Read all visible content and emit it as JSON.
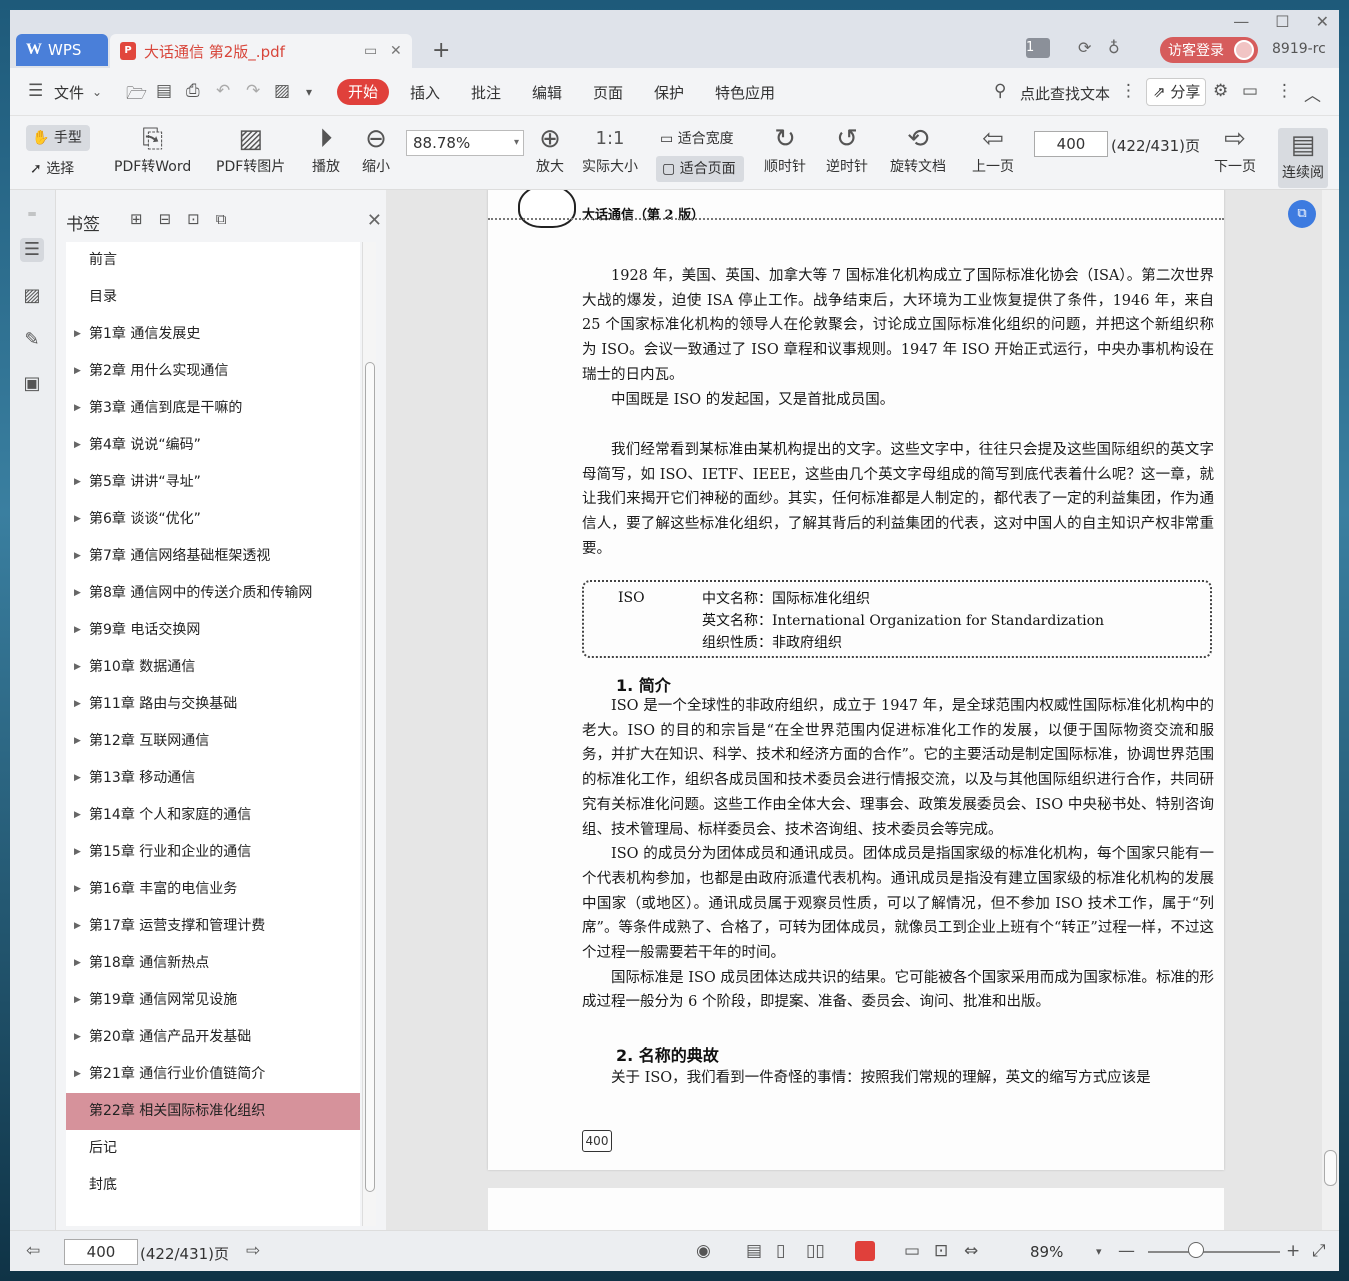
{
  "app": {
    "name": "WPS"
  },
  "tabs": {
    "doc_title": "大话通信 第2版_.pdf",
    "new_tab": "+"
  },
  "titlebar": {
    "page_badge": "1",
    "login_label": "访客登录",
    "user_id": "8919-rc"
  },
  "menu": {
    "file": "文件",
    "items": [
      "开始",
      "插入",
      "批注",
      "编辑",
      "页面",
      "保护",
      "特色应用"
    ],
    "active": "开始",
    "search_placeholder": "点此查找文本",
    "share": "分享"
  },
  "toolbar": {
    "hand": "手型",
    "select": "选择",
    "pdf_to_word": "PDF转Word",
    "pdf_to_image": "PDF转图片",
    "play": "播放",
    "zoom_out": "缩小",
    "zoom_value": "88.78%",
    "zoom_in": "放大",
    "actual_size": "实际大小",
    "fit_width": "适合宽度",
    "fit_page": "适合页面",
    "clockwise": "顺时针",
    "counter_clockwise": "逆时针",
    "rotate_doc": "旋转文档",
    "prev_page": "上一页",
    "page_input": "400",
    "page_of": "(422/431)页",
    "next_page": "下一页",
    "continuous": "连续阅"
  },
  "bookmarks": {
    "title": "书签",
    "items": [
      {
        "label": "前言",
        "expandable": false
      },
      {
        "label": "目录",
        "expandable": false
      },
      {
        "label": "第1章 通信发展史",
        "expandable": true
      },
      {
        "label": "第2章 用什么实现通信",
        "expandable": true
      },
      {
        "label": "第3章 通信到底是干嘛的",
        "expandable": true
      },
      {
        "label": "第4章 说说“编码”",
        "expandable": true
      },
      {
        "label": "第5章 讲讲“寻址”",
        "expandable": true
      },
      {
        "label": "第6章 谈谈“优化”",
        "expandable": true
      },
      {
        "label": "第7章 通信网络基础框架透视",
        "expandable": true
      },
      {
        "label": "第8章 通信网中的传送介质和传输网",
        "expandable": true
      },
      {
        "label": "第9章 电话交换网",
        "expandable": true
      },
      {
        "label": "第10章 数据通信",
        "expandable": true
      },
      {
        "label": "第11章 路由与交换基础",
        "expandable": true
      },
      {
        "label": "第12章 互联网通信",
        "expandable": true
      },
      {
        "label": "第13章 移动通信",
        "expandable": true
      },
      {
        "label": "第14章 个人和家庭的通信",
        "expandable": true
      },
      {
        "label": "第15章 行业和企业的通信",
        "expandable": true
      },
      {
        "label": "第16章 丰富的电信业务",
        "expandable": true
      },
      {
        "label": "第17章 运营支撑和管理计费",
        "expandable": true
      },
      {
        "label": "第18章 通信新热点",
        "expandable": true
      },
      {
        "label": "第19章 通信网常见设施",
        "expandable": true
      },
      {
        "label": "第20章 通信产品开发基础",
        "expandable": true
      },
      {
        "label": "第21章 通信行业价值链简介",
        "expandable": true
      },
      {
        "label": "第22章 相关国际标准化组织",
        "expandable": false,
        "active": true
      },
      {
        "label": "后记",
        "expandable": false
      },
      {
        "label": "封底",
        "expandable": false
      }
    ]
  },
  "page": {
    "running_head": "大话通信（第 2 版）",
    "para1": "1928 年，美国、英国、加拿大等 7 国标准化机构成立了国际标准化协会（ISA）。第二次世界大战的爆发，迫使 ISA 停止工作。战争结束后，大环境为工业恢复提供了条件，1946 年，来自 25 个国家标准化机构的领导人在伦敦聚会，讨论成立国际标准化组织的问题，并把这个新组织称为 ISO。会议一致通过了 ISO 章程和议事规则。1947 年 ISO 开始正式运行，中央办事机构设在瑞士的日内瓦。",
    "para2": "中国既是 ISO 的发起国，又是首批成员国。",
    "para3": "我们经常看到某标准由某机构提出的文字。这些文字中，往往只会提及这些国际组织的英文字母简写，如 ISO、IETF、IEEE，这些由几个英文字母组成的简写到底代表着什么呢？这一章，就让我们来揭开它们神秘的面纱。其实，任何标准都是人制定的，都代表了一定的利益集团，作为通信人，要了解这些标准化组织，了解其背后的利益集团的代表，这对中国人的自主知识产权非常重要。",
    "box": {
      "abbr": "ISO",
      "cn_name": "中文名称：国际标准化组织",
      "en_name": "英文名称：International Organization for Standardization",
      "nature": "组织性质：非政府组织"
    },
    "h1": "1. 简介",
    "para4": "ISO 是一个全球性的非政府组织，成立于 1947 年，是全球范围内权威性国际标准化机构中的老大。ISO 的目的和宗旨是“在全世界范围内促进标准化工作的发展，以便于国际物资交流和服务，并扩大在知识、科学、技术和经济方面的合作”。它的主要活动是制定国际标准，协调世界范围的标准化工作，组织各成员国和技术委员会进行情报交流，以及与其他国际组织进行合作，共同研究有关标准化问题。这些工作由全体大会、理事会、政策发展委员会、ISO 中央秘书处、特别咨询组、技术管理局、标样委员会、技术咨询组、技术委员会等完成。",
    "para5": "ISO 的成员分为团体成员和通讯成员。团体成员是指国家级的标准化机构，每个国家只能有一个代表机构参加，也都是由政府派遣代表机构。通讯成员是指没有建立国家级的标准化机构的发展中国家（或地区）。通讯成员属于观察员性质，可以了解情况，但不参加 ISO 技术工作，属于“列席”。等条件成熟了、合格了，可转为团体成员，就像员工到企业上班有个“转正”过程一样，不过这个过程一般需要若干年的时间。",
    "para6": "国际标准是 ISO 成员团体达成共识的结果。它可能被各个国家采用而成为国家标准。标准的形成过程一般分为 6 个阶段，即提案、准备、委员会、询问、批准和出版。",
    "h2": "2. 名称的典故",
    "para7": "关于 ISO，我们看到一件奇怪的事情：按照我们常规的理解，英文的缩写方式应该是",
    "page_number": "400"
  },
  "statusbar": {
    "page_input": "400",
    "page_of": "(422/431)页",
    "zoom": "89%"
  },
  "colors": {
    "accent": "#e0403b",
    "bookmark_active": "#d6929b",
    "wps_tab": "#4a7fd9"
  }
}
